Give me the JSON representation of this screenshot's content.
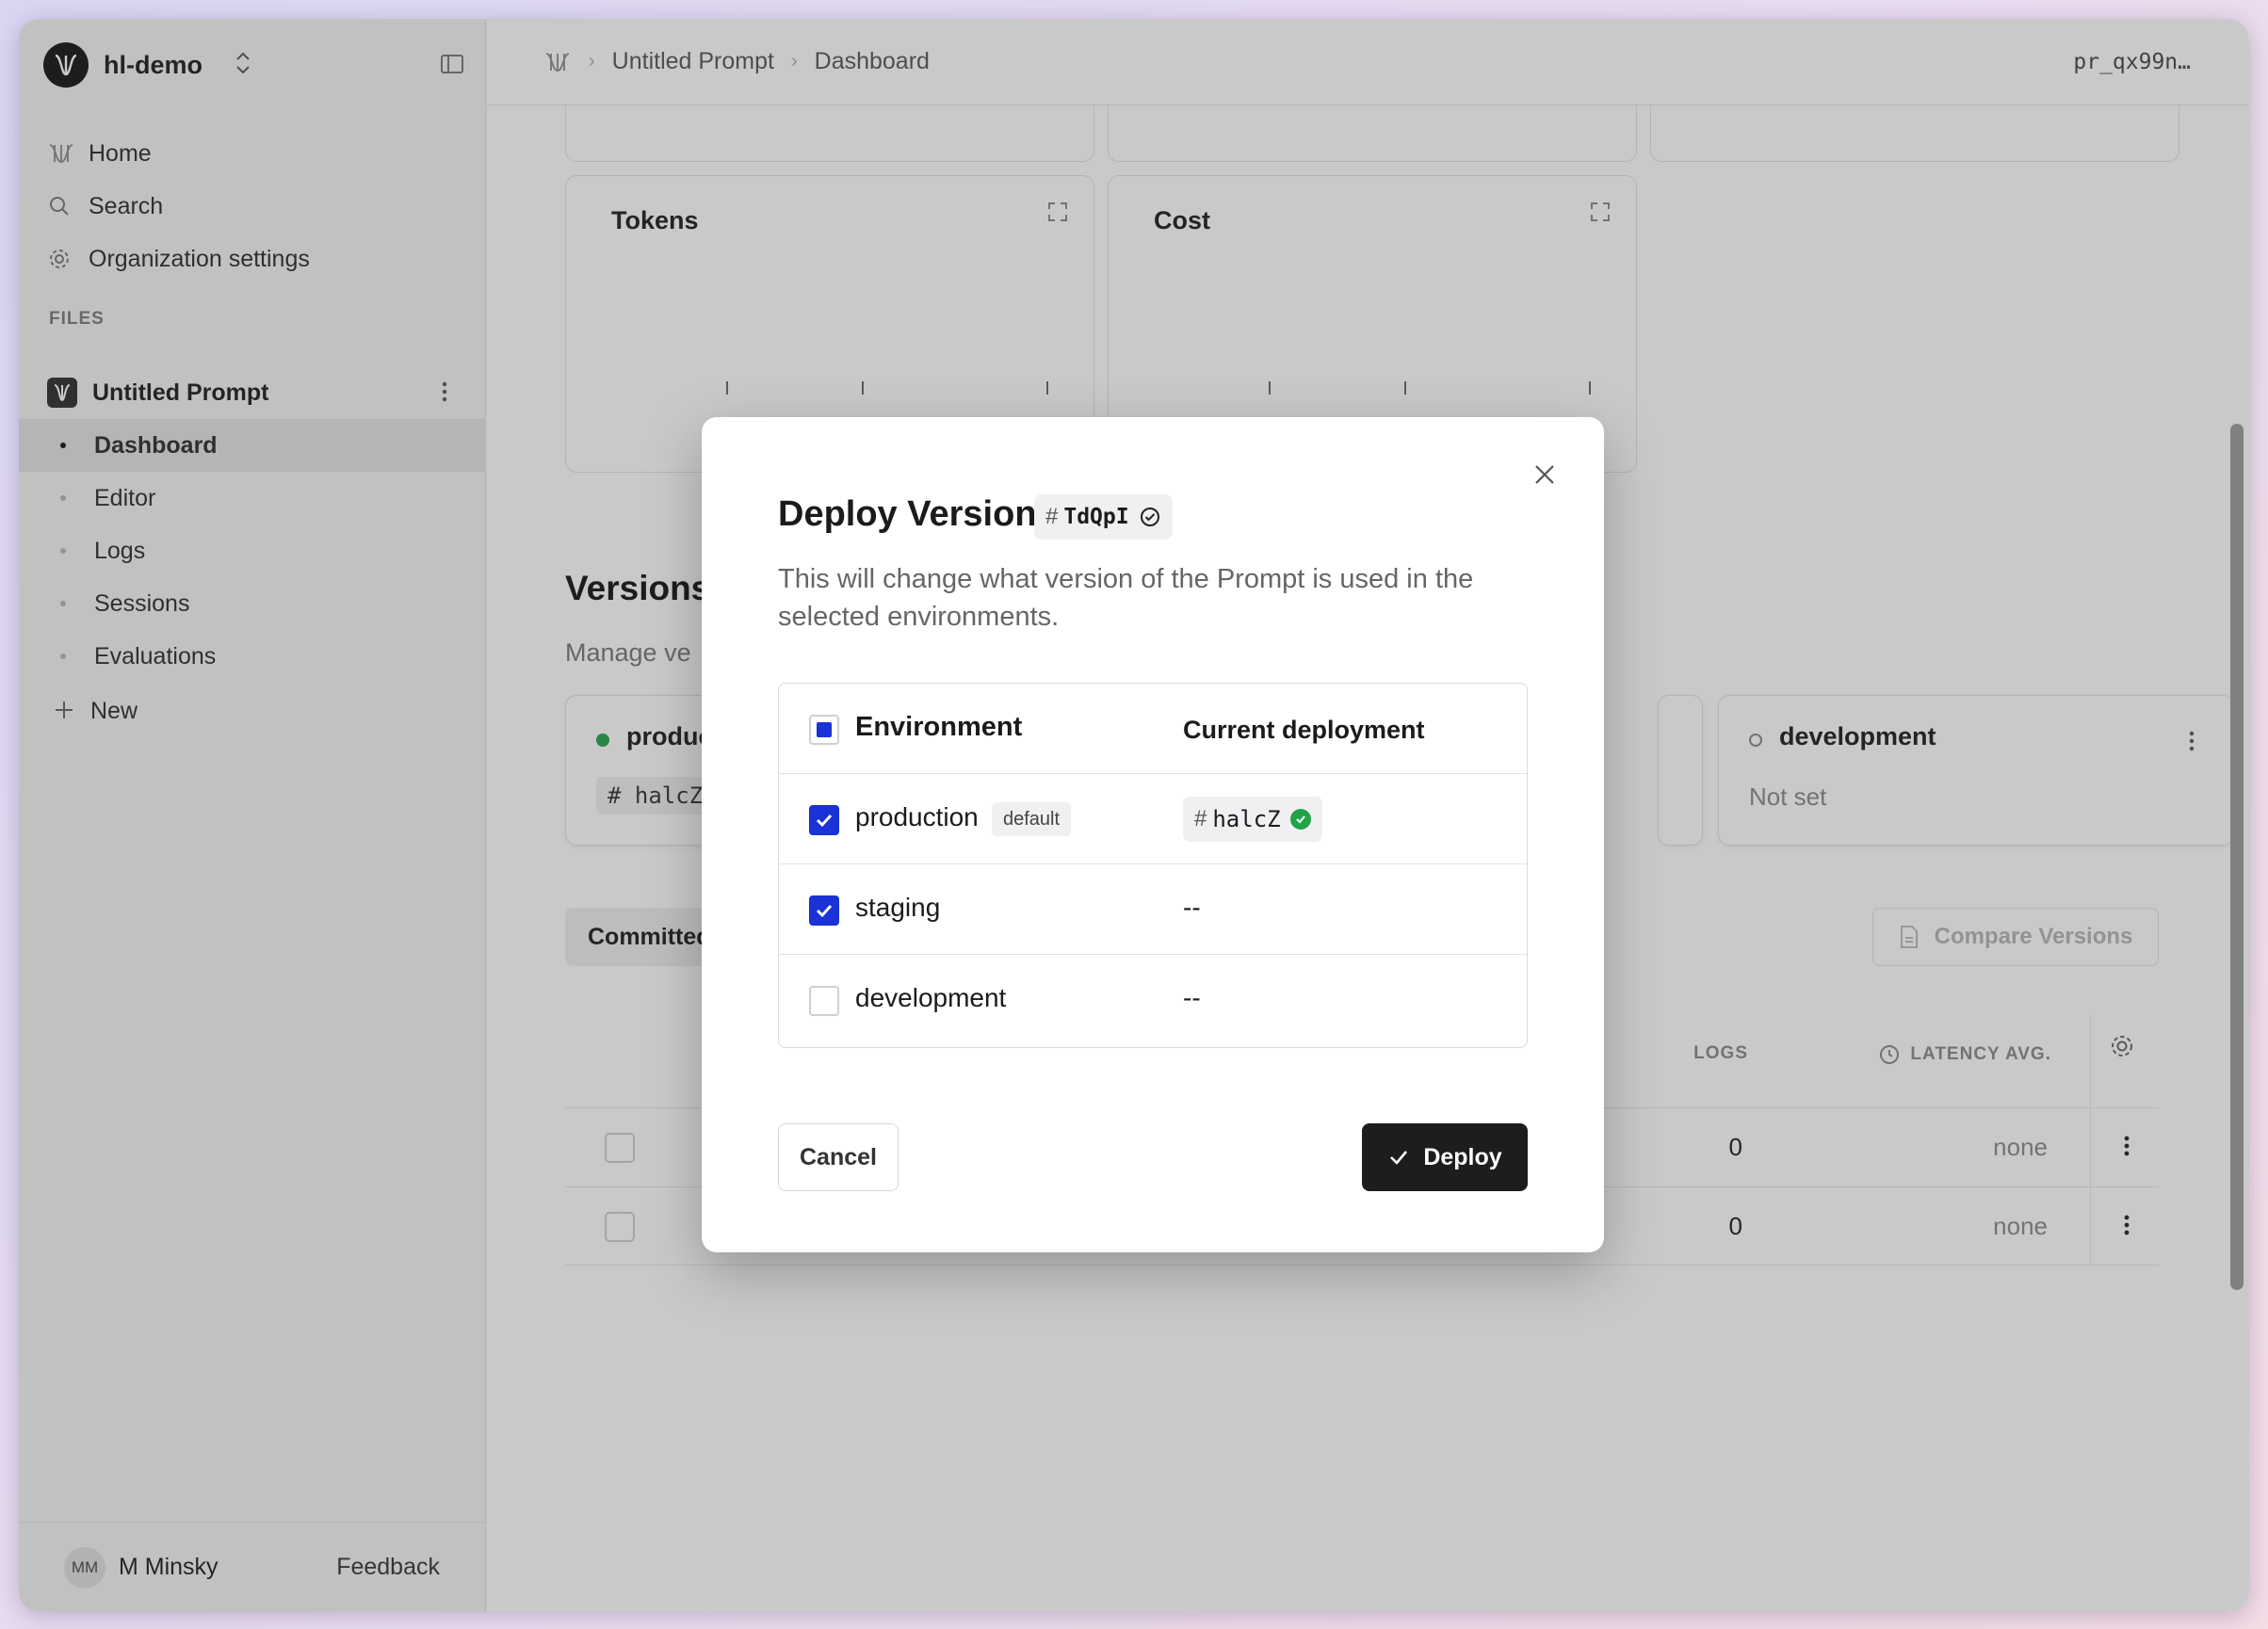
{
  "org": {
    "name": "hl-demo"
  },
  "nav": {
    "home": "Home",
    "search": "Search",
    "org_settings": "Organization settings"
  },
  "files": {
    "section_label": "FILES",
    "file_name": "Untitled Prompt",
    "items": [
      {
        "label": "Dashboard",
        "active": true
      },
      {
        "label": "Editor"
      },
      {
        "label": "Logs"
      },
      {
        "label": "Sessions"
      },
      {
        "label": "Evaluations"
      }
    ],
    "new_label": "New"
  },
  "user": {
    "initials": "MM",
    "name": "M Minsky",
    "feedback": "Feedback"
  },
  "breadcrumb": {
    "file": "Untitled Prompt",
    "page": "Dashboard",
    "id": "pr_qx99n…"
  },
  "cards": {
    "tokens": "Tokens",
    "cost": "Cost"
  },
  "versions": {
    "title": "Versions",
    "subtitle": "Manage ve",
    "env_production_name": "produc",
    "env_production_version": "halcZ",
    "env_development_name": "development",
    "env_development_value": "Not set",
    "tab_committed": "Committed",
    "compare_btn": "Compare Versions",
    "col_logs": "LOGS",
    "col_latency": "LATENCY AVG.",
    "rows": [
      {
        "logs": "0",
        "latency": "none"
      },
      {
        "logs": "0",
        "latency": "none"
      }
    ]
  },
  "modal": {
    "title": "Deploy Version",
    "version_hash": "#",
    "version_id": "TdQpI",
    "description": "This will change what version of the Prompt is used in the selected environments.",
    "header_env": "Environment",
    "header_current": "Current deployment",
    "envs": [
      {
        "name": "production",
        "badge": "default",
        "checked": true,
        "current_hash": "#",
        "current": "halcZ"
      },
      {
        "name": "staging",
        "checked": true,
        "current": "--"
      },
      {
        "name": "development",
        "checked": false,
        "current": "--"
      }
    ],
    "cancel": "Cancel",
    "deploy": "Deploy"
  },
  "colors": {
    "accent_blue": "#1a32d6",
    "success_green": "#22a34a",
    "dark_button": "#1d1d20"
  }
}
